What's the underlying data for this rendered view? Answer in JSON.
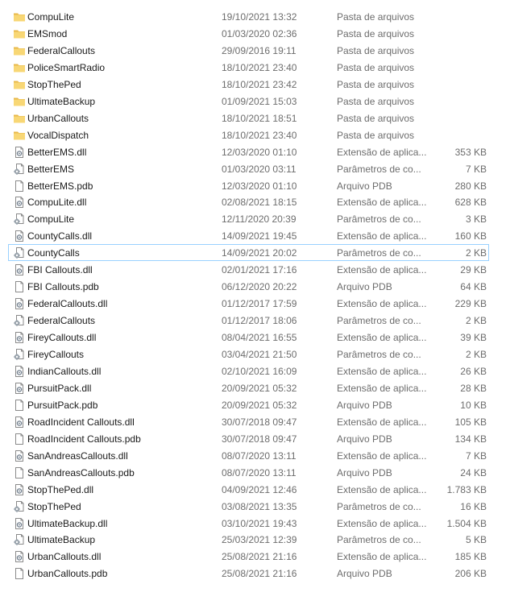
{
  "files": [
    {
      "name": "CompuLite",
      "date": "19/10/2021 13:32",
      "type": "Pasta de arquivos",
      "size": "",
      "icon": "folder-icon"
    },
    {
      "name": "EMSmod",
      "date": "01/03/2020 02:36",
      "type": "Pasta de arquivos",
      "size": "",
      "icon": "folder-icon"
    },
    {
      "name": "FederalCallouts",
      "date": "29/09/2016 19:11",
      "type": "Pasta de arquivos",
      "size": "",
      "icon": "folder-icon"
    },
    {
      "name": "PoliceSmartRadio",
      "date": "18/10/2021 23:40",
      "type": "Pasta de arquivos",
      "size": "",
      "icon": "folder-icon"
    },
    {
      "name": "StopThePed",
      "date": "18/10/2021 23:42",
      "type": "Pasta de arquivos",
      "size": "",
      "icon": "folder-icon"
    },
    {
      "name": "UltimateBackup",
      "date": "01/09/2021 15:03",
      "type": "Pasta de arquivos",
      "size": "",
      "icon": "folder-icon"
    },
    {
      "name": "UrbanCallouts",
      "date": "18/10/2021 18:51",
      "type": "Pasta de arquivos",
      "size": "",
      "icon": "folder-icon"
    },
    {
      "name": "VocalDispatch",
      "date": "18/10/2021 23:40",
      "type": "Pasta de arquivos",
      "size": "",
      "icon": "folder-icon"
    },
    {
      "name": "BetterEMS.dll",
      "date": "12/03/2020 01:10",
      "type": "Extensão de aplica...",
      "size": "353 KB",
      "icon": "dll-file-icon"
    },
    {
      "name": "BetterEMS",
      "date": "01/03/2020 03:11",
      "type": "Parâmetros de co...",
      "size": "7 KB",
      "icon": "config-file-icon"
    },
    {
      "name": "BetterEMS.pdb",
      "date": "12/03/2020 01:10",
      "type": "Arquivo PDB",
      "size": "280 KB",
      "icon": "blank-file-icon"
    },
    {
      "name": "CompuLite.dll",
      "date": "02/08/2021 18:15",
      "type": "Extensão de aplica...",
      "size": "628 KB",
      "icon": "dll-file-icon"
    },
    {
      "name": "CompuLite",
      "date": "12/11/2020 20:39",
      "type": "Parâmetros de co...",
      "size": "3 KB",
      "icon": "config-file-icon"
    },
    {
      "name": "CountyCalls.dll",
      "date": "14/09/2021 19:45",
      "type": "Extensão de aplica...",
      "size": "160 KB",
      "icon": "dll-file-icon"
    },
    {
      "name": "CountyCalls",
      "date": "14/09/2021 20:02",
      "type": "Parâmetros de co...",
      "size": "2 KB",
      "icon": "config-file-icon",
      "selected": true
    },
    {
      "name": "FBI Callouts.dll",
      "date": "02/01/2021 17:16",
      "type": "Extensão de aplica...",
      "size": "29 KB",
      "icon": "dll-file-icon"
    },
    {
      "name": "FBI Callouts.pdb",
      "date": "06/12/2020 20:22",
      "type": "Arquivo PDB",
      "size": "64 KB",
      "icon": "blank-file-icon"
    },
    {
      "name": "FederalCallouts.dll",
      "date": "01/12/2017 17:59",
      "type": "Extensão de aplica...",
      "size": "229 KB",
      "icon": "dll-file-icon"
    },
    {
      "name": "FederalCallouts",
      "date": "01/12/2017 18:06",
      "type": "Parâmetros de co...",
      "size": "2 KB",
      "icon": "config-file-icon"
    },
    {
      "name": "FireyCallouts.dll",
      "date": "08/04/2021 16:55",
      "type": "Extensão de aplica...",
      "size": "39 KB",
      "icon": "dll-file-icon"
    },
    {
      "name": "FireyCallouts",
      "date": "03/04/2021 21:50",
      "type": "Parâmetros de co...",
      "size": "2 KB",
      "icon": "config-file-icon"
    },
    {
      "name": "IndianCallouts.dll",
      "date": "02/10/2021 16:09",
      "type": "Extensão de aplica...",
      "size": "26 KB",
      "icon": "dll-file-icon"
    },
    {
      "name": "PursuitPack.dll",
      "date": "20/09/2021 05:32",
      "type": "Extensão de aplica...",
      "size": "28 KB",
      "icon": "dll-file-icon"
    },
    {
      "name": "PursuitPack.pdb",
      "date": "20/09/2021 05:32",
      "type": "Arquivo PDB",
      "size": "10 KB",
      "icon": "blank-file-icon"
    },
    {
      "name": "RoadIncident Callouts.dll",
      "date": "30/07/2018 09:47",
      "type": "Extensão de aplica...",
      "size": "105 KB",
      "icon": "dll-file-icon"
    },
    {
      "name": "RoadIncident Callouts.pdb",
      "date": "30/07/2018 09:47",
      "type": "Arquivo PDB",
      "size": "134 KB",
      "icon": "blank-file-icon"
    },
    {
      "name": "SanAndreasCallouts.dll",
      "date": "08/07/2020 13:11",
      "type": "Extensão de aplica...",
      "size": "7 KB",
      "icon": "dll-file-icon"
    },
    {
      "name": "SanAndreasCallouts.pdb",
      "date": "08/07/2020 13:11",
      "type": "Arquivo PDB",
      "size": "24 KB",
      "icon": "blank-file-icon"
    },
    {
      "name": "StopThePed.dll",
      "date": "04/09/2021 12:46",
      "type": "Extensão de aplica...",
      "size": "1.783 KB",
      "icon": "dll-file-icon"
    },
    {
      "name": "StopThePed",
      "date": "03/08/2021 13:35",
      "type": "Parâmetros de co...",
      "size": "16 KB",
      "icon": "config-file-icon"
    },
    {
      "name": "UltimateBackup.dll",
      "date": "03/10/2021 19:43",
      "type": "Extensão de aplica...",
      "size": "1.504 KB",
      "icon": "dll-file-icon"
    },
    {
      "name": "UltimateBackup",
      "date": "25/03/2021 12:39",
      "type": "Parâmetros de co...",
      "size": "5 KB",
      "icon": "config-file-icon"
    },
    {
      "name": "UrbanCallouts.dll",
      "date": "25/08/2021 21:16",
      "type": "Extensão de aplica...",
      "size": "185 KB",
      "icon": "dll-file-icon"
    },
    {
      "name": "UrbanCallouts.pdb",
      "date": "25/08/2021 21:16",
      "type": "Arquivo PDB",
      "size": "206 KB",
      "icon": "blank-file-icon"
    }
  ],
  "colors": {
    "folder": "#f8d775",
    "selection_border": "#99d1ff",
    "secondary_text": "#6d6d6d"
  }
}
